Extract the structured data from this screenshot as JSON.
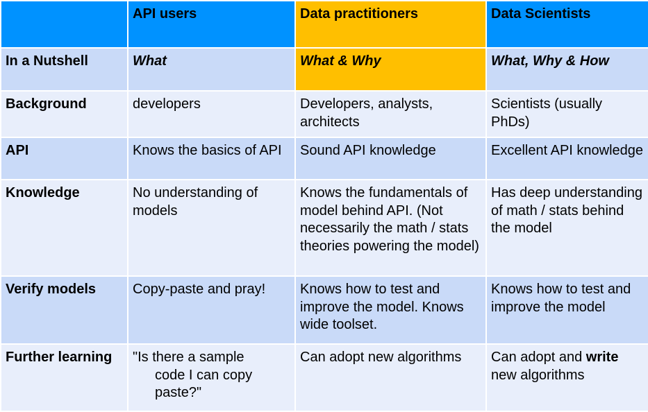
{
  "header": {
    "col1": "",
    "col2": "API users",
    "col3": "Data practitioners",
    "col4": "Data Scientists"
  },
  "rows": [
    {
      "label": "In a Nutshell",
      "api_users": "What",
      "data_practitioners": "What & Why",
      "data_scientists": "What, Why & How"
    },
    {
      "label": "Background",
      "api_users": "developers",
      "data_practitioners": "Developers, analysts, architects",
      "data_scientists": "Scientists (usually PhDs)"
    },
    {
      "label": "API",
      "api_users": "Knows the basics of API",
      "data_practitioners": "Sound API knowledge",
      "data_scientists": "Excellent API knowledge"
    },
    {
      "label": "Knowledge",
      "api_users": "No understanding of models",
      "data_practitioners": "Knows the fundamentals of  model behind API. (Not necessarily the math / stats theories powering the model)",
      "data_scientists": "Has deep understanding of math / stats behind the model"
    },
    {
      "label": "Verify models",
      "api_users": "Copy-paste and pray!",
      "data_practitioners": "Knows how to test and improve the model. Knows wide toolset.",
      "data_scientists": "Knows how to test and improve the model"
    },
    {
      "label": "Further learning",
      "api_users_line1": "\"Is there a sample",
      "api_users_line2": "code I can copy paste?\"",
      "data_practitioners": "Can adopt new algorithms",
      "data_scientists_pre": "Can adopt and ",
      "data_scientists_bold": "write",
      "data_scientists_post": " new algorithms"
    }
  ],
  "colors": {
    "header_blue": "#0092ff",
    "highlight_gold": "#ffbf00",
    "row_dark": "#c9daf8",
    "row_light": "#e8eefb"
  }
}
